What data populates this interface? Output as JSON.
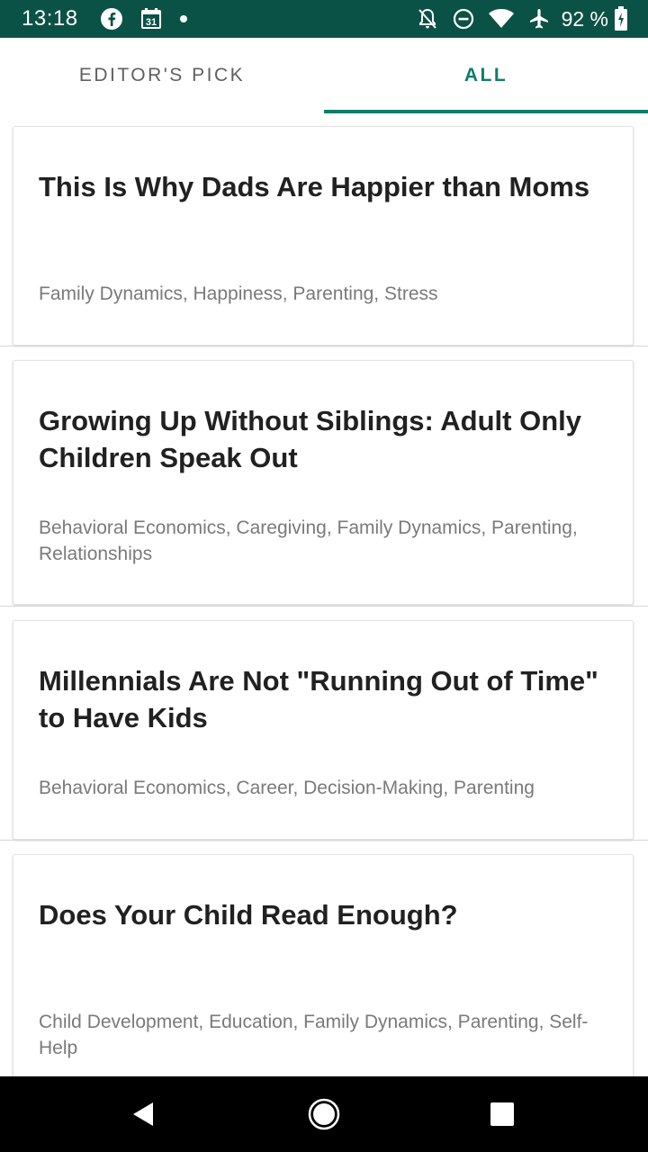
{
  "status_bar": {
    "time": "13:18",
    "calendar_day": "31",
    "battery_percent": "92 %",
    "left_icons": [
      "facebook-icon",
      "calendar-icon",
      "dot-icon"
    ],
    "right_icons": [
      "notifications-off-icon",
      "do-not-disturb-icon",
      "wifi-icon",
      "airplane-icon",
      "battery-icon"
    ]
  },
  "tabs": [
    {
      "label": "EDITOR'S PICK",
      "selected": false
    },
    {
      "label": "ALL",
      "selected": true
    }
  ],
  "colors": {
    "status_bar": "#0b5246",
    "accent": "#0e7d6b",
    "title_text": "#212121",
    "tag_text": "#7a7a7a"
  },
  "articles": [
    {
      "title": "This Is Why Dads Are Happier than Moms",
      "tags": "Family Dynamics, Happiness, Parenting, Stress"
    },
    {
      "title": "Growing Up Without Siblings: Adult Only Children Speak Out",
      "tags": "Behavioral Economics, Caregiving, Family Dynamics, Parenting, Relationships"
    },
    {
      "title": "Millennials Are Not \"Running Out of Time\" to Have Kids",
      "tags": "Behavioral Economics, Career, Decision-Making, Parenting"
    },
    {
      "title": "Does Your Child Read Enough?",
      "tags": "Child Development, Education, Family Dynamics, Parenting, Self-Help"
    }
  ],
  "nav_bar": {
    "icons": [
      "back-icon",
      "home-icon",
      "recents-icon"
    ]
  }
}
